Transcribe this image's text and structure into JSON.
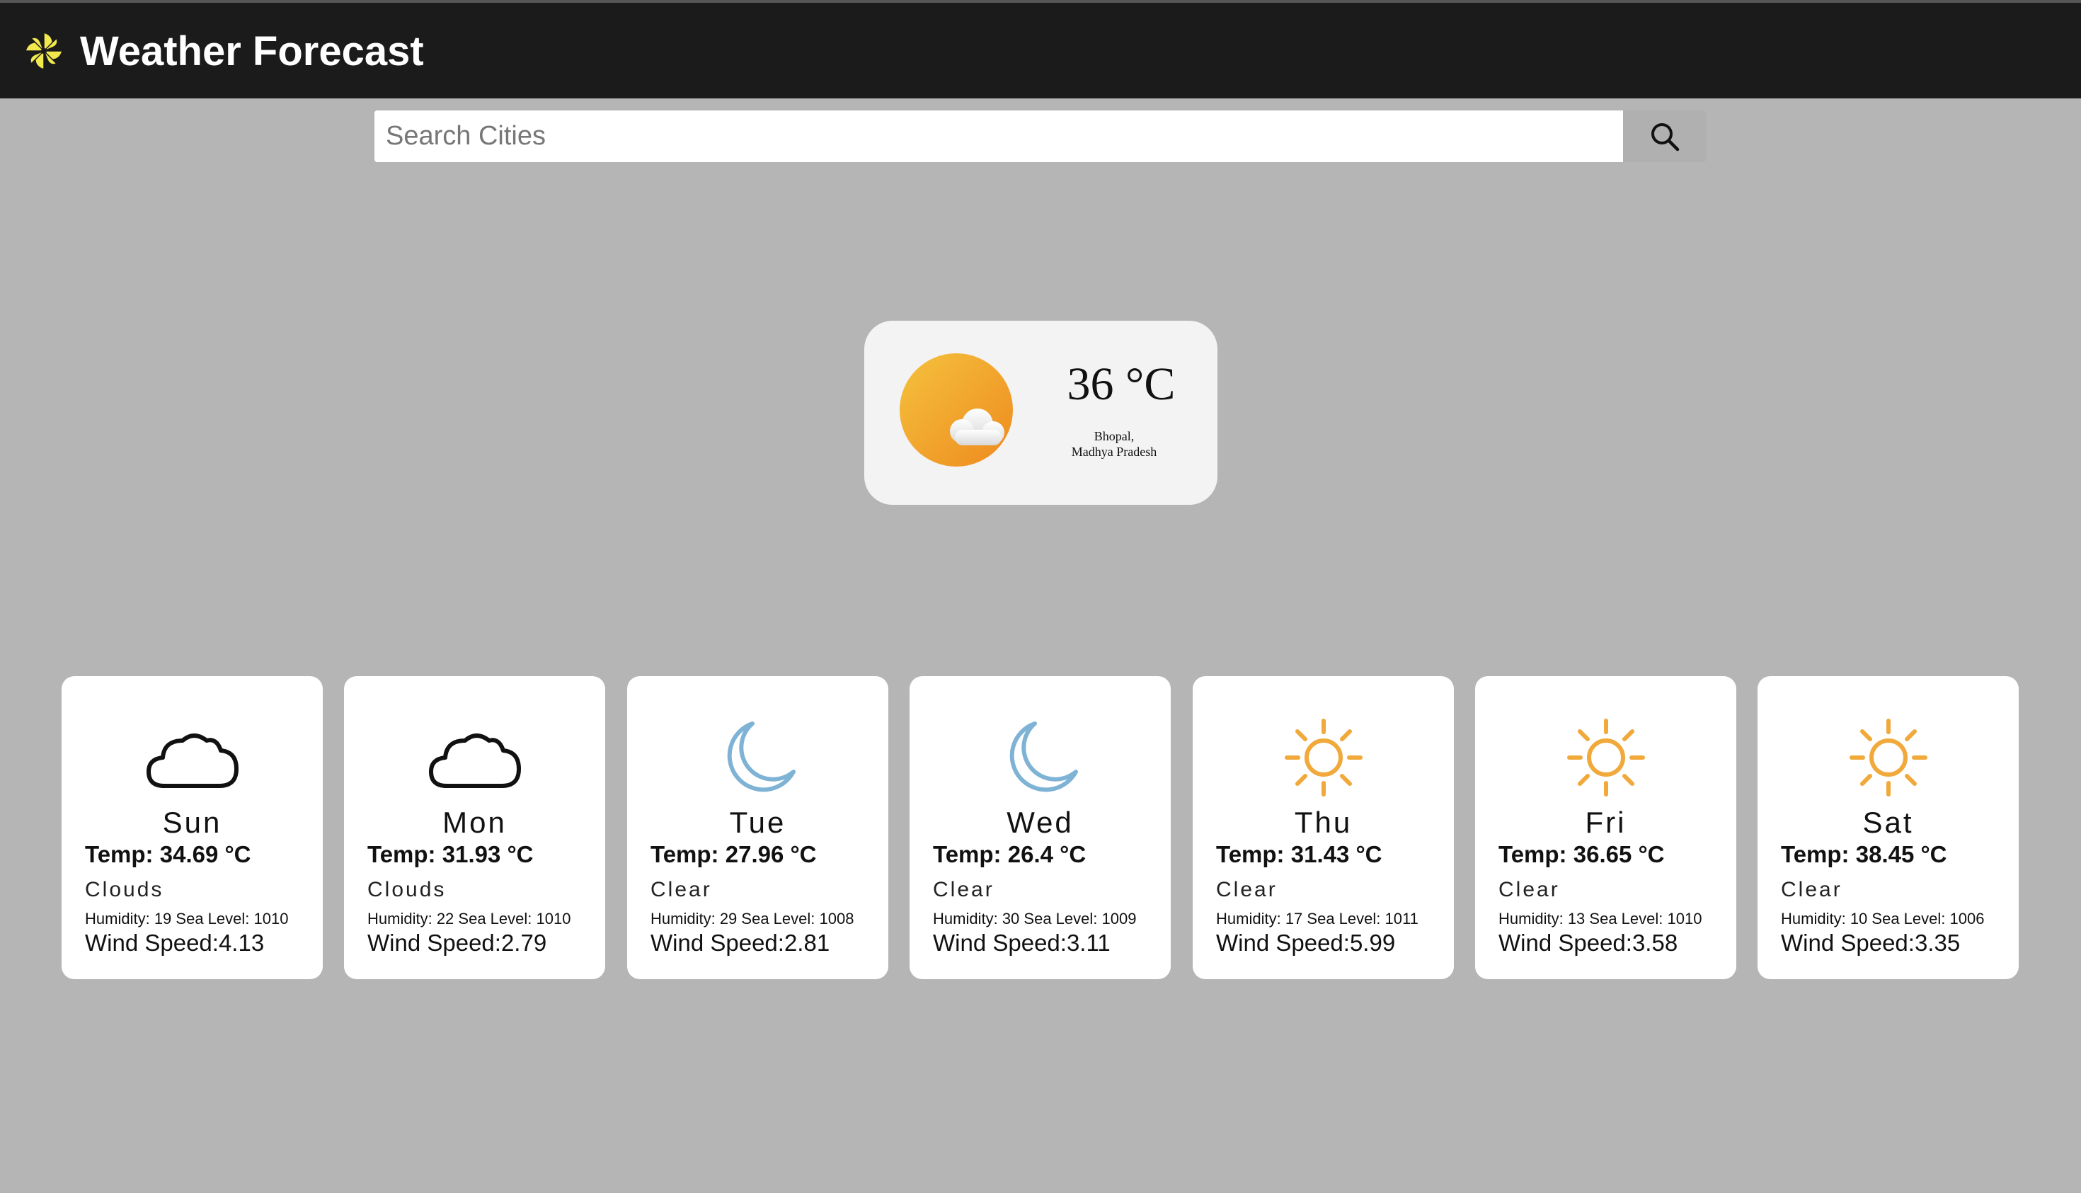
{
  "header": {
    "title": "Weather Forecast",
    "logo_icon": "pinwheel-icon",
    "logo_color": "#f2e94e"
  },
  "search": {
    "placeholder": "Search Cities",
    "value": "",
    "button_icon": "search-icon"
  },
  "current": {
    "temp": "36 °C",
    "city": "Bhopal,",
    "region": "Madhya Pradesh",
    "icon": "sun-behind-cloud-icon"
  },
  "forecast": [
    {
      "day": "Sun",
      "temp_label": "Temp:",
      "temp": "34.69 °C",
      "desc": "Clouds",
      "humidity_label": "Humidity:",
      "humidity": "19",
      "sea_label": "Sea Level:",
      "sea_level": "1010",
      "wind_label": "Wind Speed:",
      "wind": "4.13",
      "icon": "cloud-icon"
    },
    {
      "day": "Mon",
      "temp_label": "Temp:",
      "temp": "31.93 °C",
      "desc": "Clouds",
      "humidity_label": "Humidity:",
      "humidity": "22",
      "sea_label": "Sea Level:",
      "sea_level": "1010",
      "wind_label": "Wind Speed:",
      "wind": "2.79",
      "icon": "cloud-icon"
    },
    {
      "day": "Tue",
      "temp_label": "Temp:",
      "temp": "27.96 °C",
      "desc": "Clear",
      "humidity_label": "Humidity:",
      "humidity": "29",
      "sea_label": "Sea Level:",
      "sea_level": "1008",
      "wind_label": "Wind Speed:",
      "wind": "2.81",
      "icon": "moon-icon"
    },
    {
      "day": "Wed",
      "temp_label": "Temp:",
      "temp": "26.4 °C",
      "desc": "Clear",
      "humidity_label": "Humidity:",
      "humidity": "30",
      "sea_label": "Sea Level:",
      "sea_level": "1009",
      "wind_label": "Wind Speed:",
      "wind": "3.11",
      "icon": "moon-icon"
    },
    {
      "day": "Thu",
      "temp_label": "Temp:",
      "temp": "31.43 °C",
      "desc": "Clear",
      "humidity_label": "Humidity:",
      "humidity": "17",
      "sea_label": "Sea Level:",
      "sea_level": "1011",
      "wind_label": "Wind Speed:",
      "wind": "5.99",
      "icon": "sun-icon"
    },
    {
      "day": "Fri",
      "temp_label": "Temp:",
      "temp": "36.65 °C",
      "desc": "Clear",
      "humidity_label": "Humidity:",
      "humidity": "13",
      "sea_label": "Sea Level:",
      "sea_level": "1010",
      "wind_label": "Wind Speed:",
      "wind": "3.58",
      "icon": "sun-icon"
    },
    {
      "day": "Sat",
      "temp_label": "Temp:",
      "temp": "38.45 °C",
      "desc": "Clear",
      "humidity_label": "Humidity:",
      "humidity": "10",
      "sea_label": "Sea Level:",
      "sea_level": "1006",
      "wind_label": "Wind Speed:",
      "wind": "3.35",
      "icon": "sun-icon"
    }
  ],
  "colors": {
    "navbar": "#1b1b1b",
    "background": "#b5b5b5",
    "sun": "#f0a93a",
    "moon": "#7fb3d5",
    "cloud_stroke": "#111111"
  }
}
